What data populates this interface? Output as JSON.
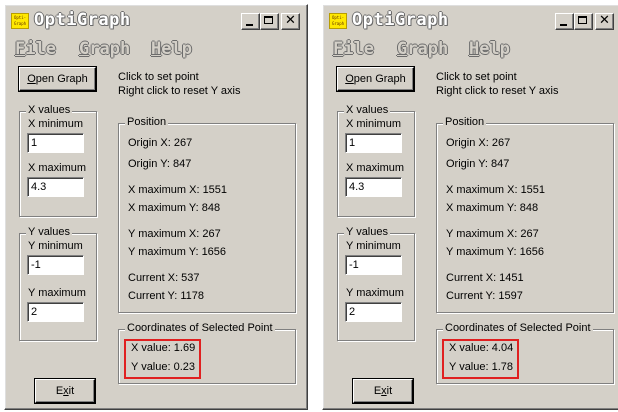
{
  "windows": [
    {
      "title": "OptiGraph",
      "icon_text": "Opti-Graph",
      "menu": [
        {
          "accel": "F",
          "rest": "ile"
        },
        {
          "accel": "G",
          "rest": "raph"
        },
        {
          "accel": "H",
          "rest": "elp"
        }
      ],
      "open_button": {
        "accel": "O",
        "rest": "pen Graph"
      },
      "instructions": [
        "Click to set point",
        "Right click to reset Y axis"
      ],
      "x_values": {
        "legend": "X values",
        "min_label": "X minimum",
        "min_value": "1",
        "max_label": "X maximum",
        "max_value": "4.3"
      },
      "y_values": {
        "legend": "Y values",
        "min_label": "Y minimum",
        "min_value": "-1",
        "max_label": "Y maximum",
        "max_value": "2"
      },
      "position": {
        "legend": "Position",
        "lines": [
          "Origin X:  267",
          "Origin Y:  847",
          "X maximum X:  1551",
          "X maximum Y:  848",
          "Y maximum X:  267",
          "Y maximum Y:  1656",
          "Current X:  537",
          "Current Y:  1178"
        ]
      },
      "coordinates": {
        "legend": "Coordinates of Selected Point",
        "x_value": "X value: 1.69",
        "y_value": "Y value: 0.23"
      },
      "exit_button": {
        "prefix": "E",
        "accel": "x",
        "rest": "it"
      }
    },
    {
      "title": "OptiGraph",
      "icon_text": "Opti-Graph",
      "menu": [
        {
          "accel": "F",
          "rest": "ile"
        },
        {
          "accel": "G",
          "rest": "raph"
        },
        {
          "accel": "H",
          "rest": "elp"
        }
      ],
      "open_button": {
        "accel": "O",
        "rest": "pen Graph"
      },
      "instructions": [
        "Click to set point",
        "Right click to reset Y axis"
      ],
      "x_values": {
        "legend": "X values",
        "min_label": "X minimum",
        "min_value": "1",
        "max_label": "X maximum",
        "max_value": "4.3"
      },
      "y_values": {
        "legend": "Y values",
        "min_label": "Y minimum",
        "min_value": "-1",
        "max_label": "Y maximum",
        "max_value": "2"
      },
      "position": {
        "legend": "Position",
        "lines": [
          "Origin X:  267",
          "Origin Y:  847",
          "X maximum X:  1551",
          "X maximum Y:  848",
          "Y maximum X:  267",
          "Y maximum Y:  1656",
          "Current X:  1451",
          "Current Y:  1597"
        ]
      },
      "coordinates": {
        "legend": "Coordinates of Selected Point",
        "x_value": "X value: 4.04",
        "y_value": "Y value: 1.78"
      },
      "exit_button": {
        "prefix": "E",
        "accel": "x",
        "rest": "it"
      }
    }
  ],
  "colors": {
    "window_face": "#d4d0c8",
    "highlight_box": "#e02020",
    "icon_background": "#ffe800"
  },
  "icons": {
    "app": "optigraph-app-icon",
    "minimize": "minimize-icon",
    "maximize": "maximize-icon",
    "close": "close-icon"
  }
}
